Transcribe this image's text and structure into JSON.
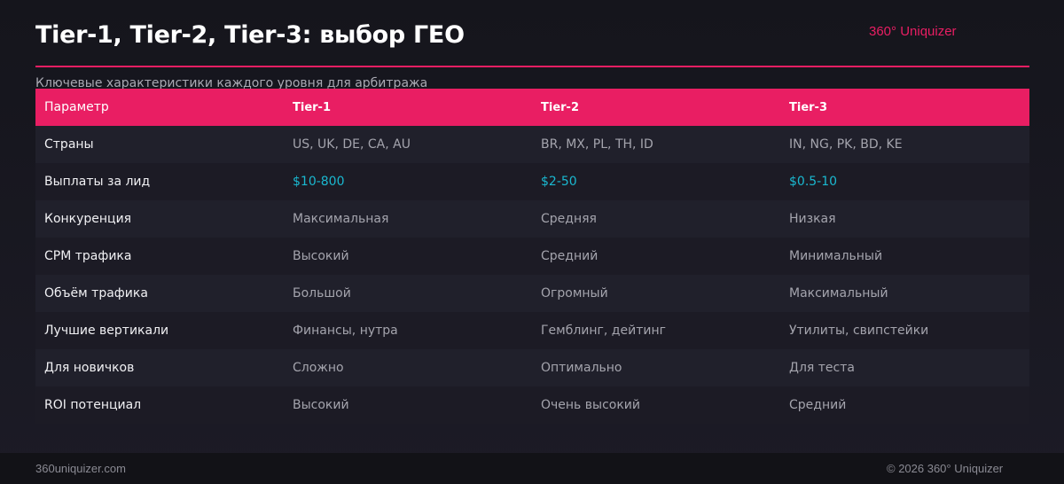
{
  "header": {
    "title": "Tier-1, Tier-2, Tier-3: выбор ГЕО",
    "brand": "360° Uniquizer",
    "subtitle": "Ключевые характеристики каждого уровня для арбитража"
  },
  "table": {
    "columns": [
      "Параметр",
      "Tier-1",
      "Tier-2",
      "Tier-3"
    ],
    "rows": [
      {
        "param": "Страны",
        "tier1": "US, UK, DE, CA, AU",
        "tier2": "BR, MX, PL, TH, ID",
        "tier3": "IN, NG, PK, BD, KE"
      },
      {
        "param": "Выплаты за лид",
        "tier1": "$10-800",
        "tier2": "$2-50",
        "tier3": "$0.5-10"
      },
      {
        "param": "Конкуренция",
        "tier1": "Максимальная",
        "tier2": "Средняя",
        "tier3": "Низкая"
      },
      {
        "param": "CPM трафика",
        "tier1": "Высокий",
        "tier2": "Средний",
        "tier3": "Минимальный"
      },
      {
        "param": "Объём трафика",
        "tier1": "Большой",
        "tier2": "Огромный",
        "tier3": "Максимальный"
      },
      {
        "param": "Лучшие вертикали",
        "tier1": "Финансы, нутра",
        "tier2": "Гемблинг, дейтинг",
        "tier3": "Утилиты, свипстейки"
      },
      {
        "param": "Для новичков",
        "tier1": "Сложно",
        "tier2": "Оптимально",
        "tier3": "Для теста"
      },
      {
        "param": "ROI потенциал",
        "tier1": "Высокий",
        "tier2": "Очень высокий",
        "tier3": "Средний"
      }
    ]
  },
  "footer": {
    "site": "360uniquizer.com",
    "copyright": "© 2026 360° Uniquizer"
  },
  "colors": {
    "accent": "#e91e63",
    "payout": "#1ab8d0",
    "background": "#1a1924"
  }
}
